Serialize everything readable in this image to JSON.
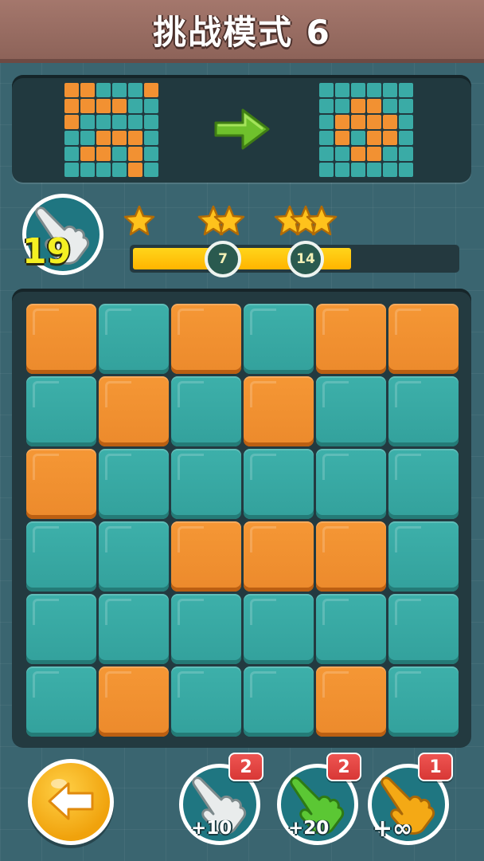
{
  "header": {
    "title": "挑战模式 6"
  },
  "target": {
    "start_pattern": [
      [
        "O",
        "O",
        "T",
        "T",
        "T",
        "O"
      ],
      [
        "O",
        "O",
        "O",
        "O",
        "T",
        "T"
      ],
      [
        "O",
        "T",
        "T",
        "T",
        "T",
        "T"
      ],
      [
        "T",
        "T",
        "O",
        "O",
        "O",
        "T"
      ],
      [
        "T",
        "O",
        "O",
        "T",
        "O",
        "T"
      ],
      [
        "T",
        "T",
        "T",
        "T",
        "O",
        "T"
      ]
    ],
    "goal_pattern": [
      [
        "T",
        "T",
        "T",
        "T",
        "T",
        "T"
      ],
      [
        "T",
        "T",
        "O",
        "O",
        "T",
        "T"
      ],
      [
        "T",
        "O",
        "O",
        "O",
        "O",
        "T"
      ],
      [
        "T",
        "O",
        "T",
        "O",
        "O",
        "T"
      ],
      [
        "T",
        "T",
        "O",
        "O",
        "T",
        "T"
      ],
      [
        "T",
        "T",
        "T",
        "T",
        "T",
        "T"
      ]
    ],
    "arrow_icon": "arrow-right-icon"
  },
  "moves": {
    "count": "19",
    "icon": "pointing-hand-icon"
  },
  "progress": {
    "fill_fraction": 0.675,
    "milestones": [
      {
        "value": "7",
        "stars": 2
      },
      {
        "value": "14",
        "stars": 3
      }
    ],
    "first_star_count": 1
  },
  "board": {
    "rows": [
      [
        "O",
        "T",
        "O",
        "T",
        "O",
        "O"
      ],
      [
        "T",
        "O",
        "T",
        "O",
        "T",
        "T"
      ],
      [
        "O",
        "T",
        "T",
        "T",
        "T",
        "T"
      ],
      [
        "T",
        "T",
        "O",
        "O",
        "O",
        "T"
      ],
      [
        "T",
        "T",
        "T",
        "T",
        "T",
        "T"
      ],
      [
        "T",
        "O",
        "T",
        "T",
        "O",
        "T"
      ]
    ],
    "colors": {
      "O": "#f29132",
      "T": "#3aaba6"
    }
  },
  "footer": {
    "back_icon": "back-arrow-icon",
    "powerups": [
      {
        "label": "+10",
        "count": "2",
        "icon": "white-hand-icon",
        "color": "#e9ecec"
      },
      {
        "label": "+20",
        "count": "2",
        "icon": "green-hand-icon",
        "color": "#5bc734"
      },
      {
        "label": "+∞",
        "count": "1",
        "icon": "gold-hand-icon",
        "color": "#f4a915"
      }
    ]
  }
}
